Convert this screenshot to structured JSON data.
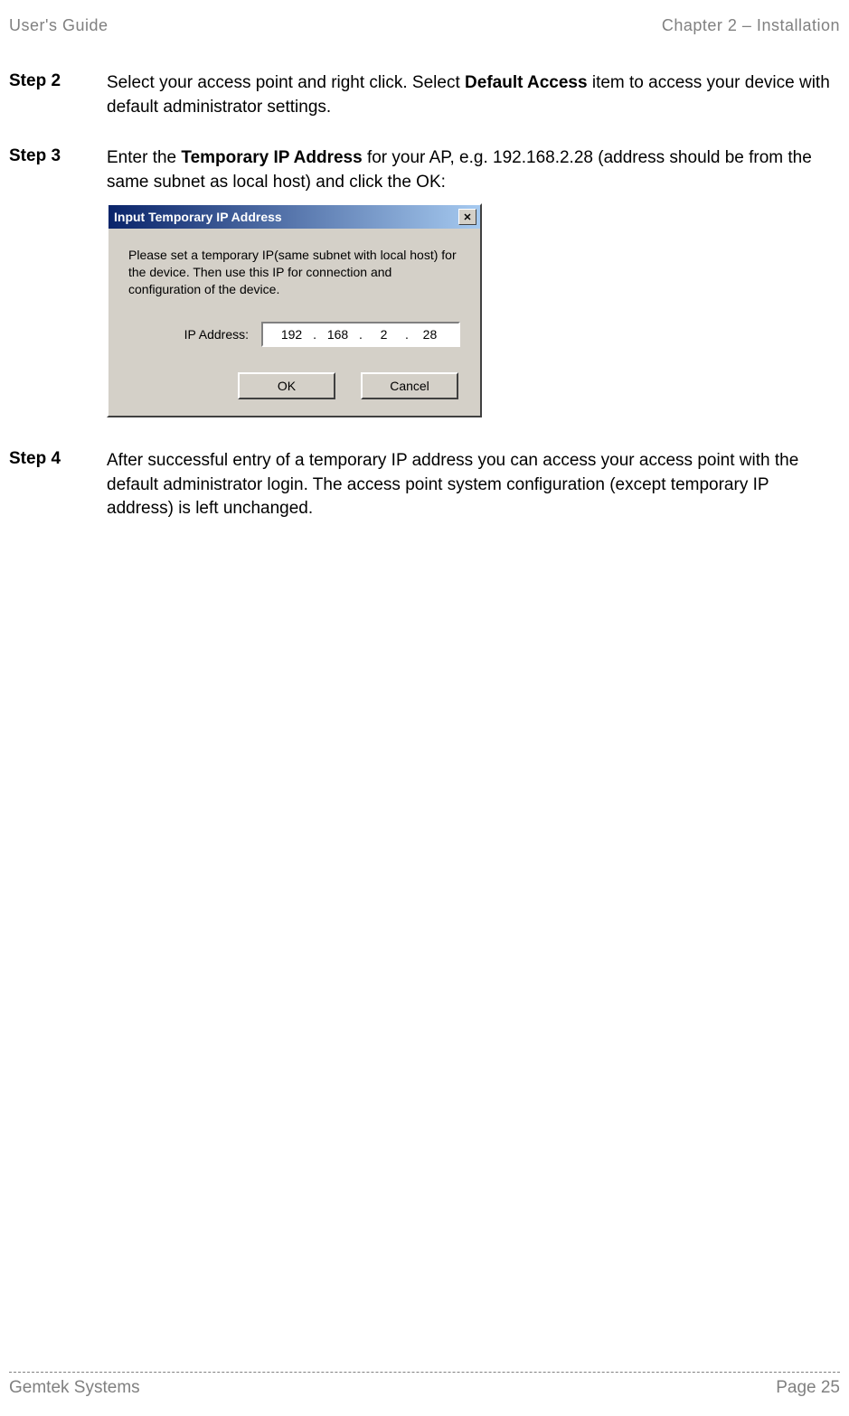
{
  "header": {
    "left": "User's Guide",
    "right": "Chapter 2 – Installation"
  },
  "steps": {
    "step2": {
      "label": "Step 2",
      "text_before": "Select your access point and right click. Select ",
      "bold": "Default Access",
      "text_after": " item to access your device with default administrator settings."
    },
    "step3": {
      "label": "Step 3",
      "text_before": "Enter the ",
      "bold": "Temporary IP Address",
      "text_after": " for your AP, e.g. 192.168.2.28 (address should be from the same subnet as local host) and click the OK:"
    },
    "step4": {
      "label": "Step 4",
      "text": "After successful entry of a temporary IP address you can access your access point with the default administrator login. The access point system configuration (except temporary IP address) is left unchanged."
    }
  },
  "dialog": {
    "title": "Input Temporary IP Address",
    "close": "✕",
    "instruction": "Please set a temporary IP(same subnet with local host) for the device. Then use this IP for connection and configuration  of the device.",
    "ip_label": "IP Address:",
    "ip": {
      "seg1": "192",
      "seg2": "168",
      "seg3": "2",
      "seg4": "28"
    },
    "ok_button": "OK",
    "cancel_button": "Cancel"
  },
  "footer": {
    "left": "Gemtek Systems",
    "right": "Page 25"
  }
}
